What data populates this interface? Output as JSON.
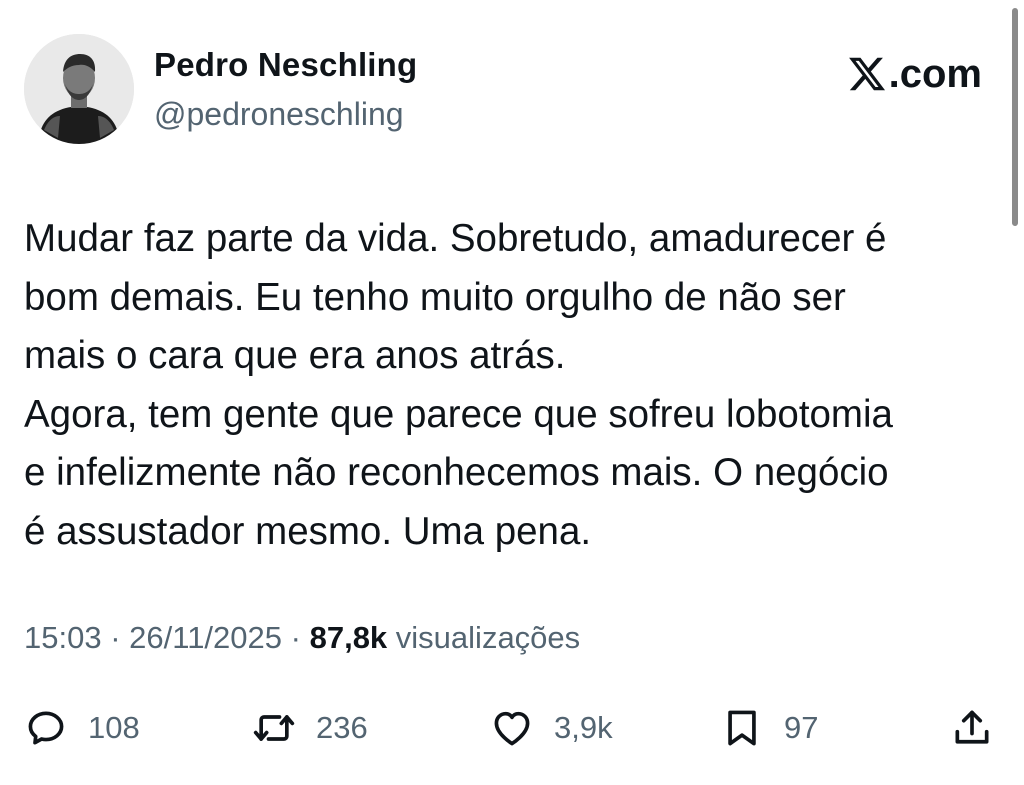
{
  "author": {
    "name": "Pedro Neschling",
    "handle": "@pedroneschling"
  },
  "brand": {
    "label": ".com",
    "icon": "x-logo-icon"
  },
  "tweet": {
    "text": "Mudar faz parte da vida. Sobretudo, amadurecer é\nbom demais. Eu tenho muito orgulho de não ser\nmais o cara que era anos atrás.\nAgora, tem gente que parece que sofreu lobotomia\ne infelizmente não reconhecemos mais. O negócio\né assustador mesmo. Uma pena.",
    "time": "15:03",
    "date": "26/11/2025",
    "separator": "·",
    "views_count": "87,8k",
    "views_label": "visualizações"
  },
  "actions": {
    "replies": "108",
    "reposts": "236",
    "likes": "3,9k",
    "bookmarks": "97"
  },
  "colors": {
    "text": "#0f1419",
    "secondary": "#536471",
    "background": "#ffffff"
  }
}
